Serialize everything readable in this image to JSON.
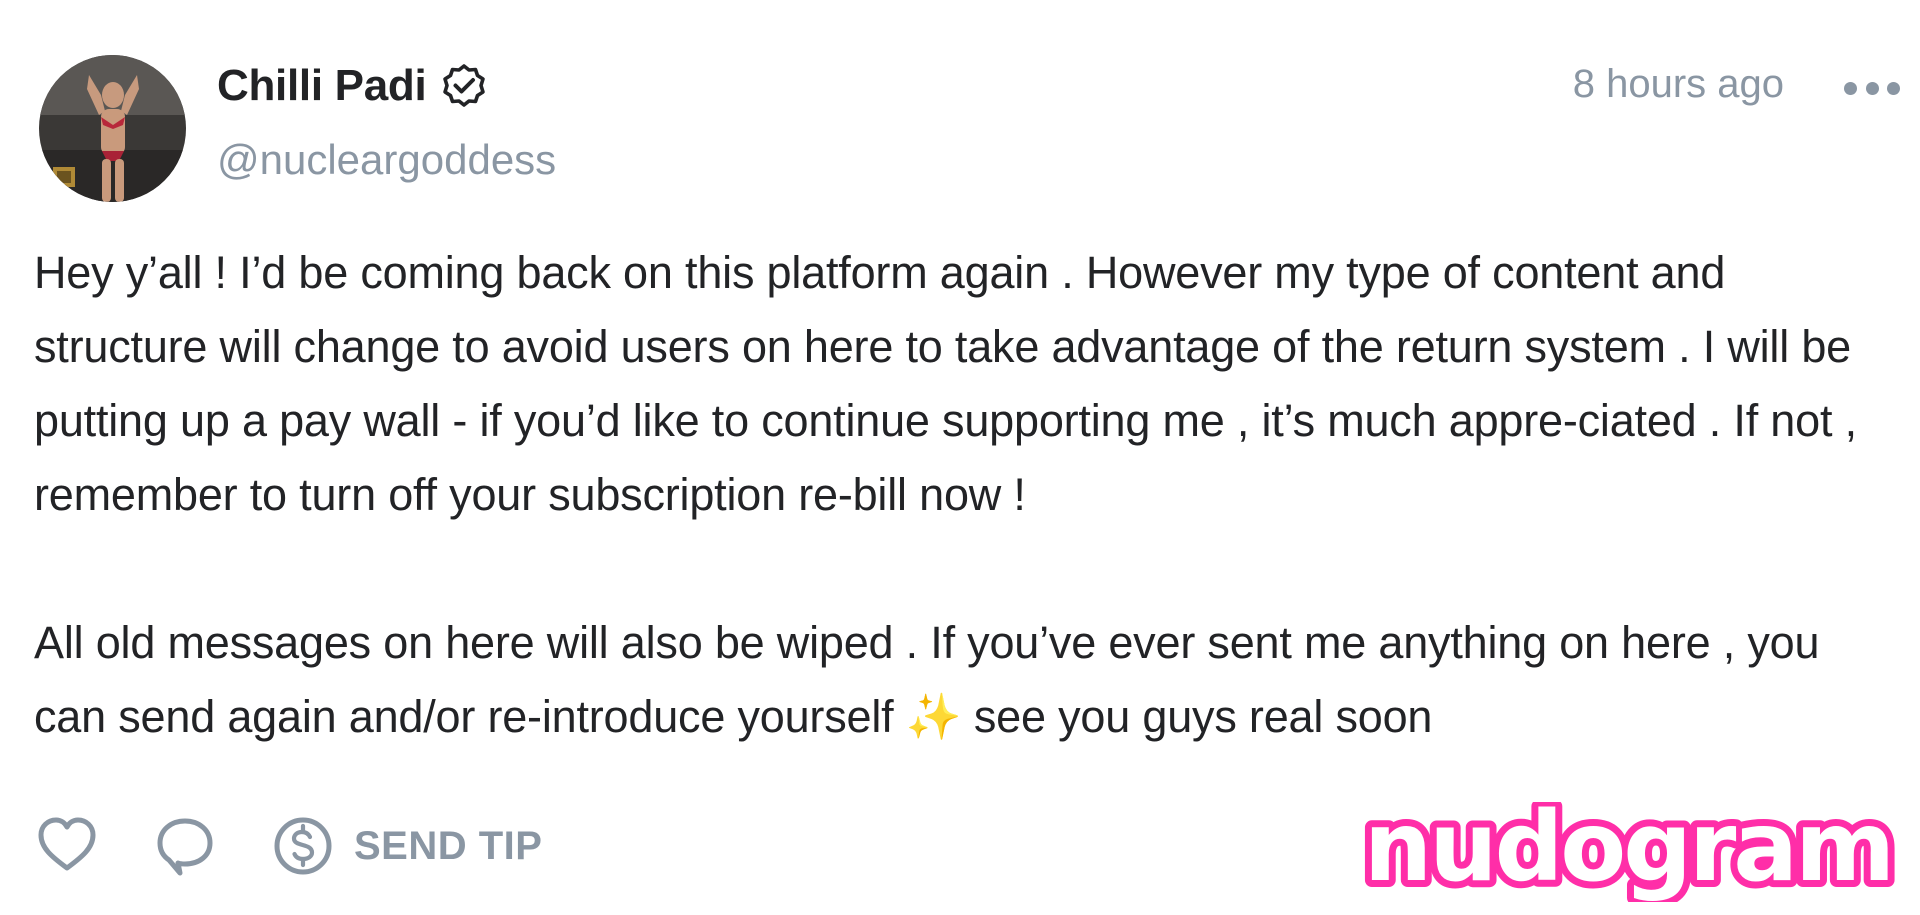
{
  "post": {
    "author": {
      "display_name": "Chilli Padi",
      "handle": "@nucleargoddess",
      "verified": true
    },
    "timestamp": "8 hours ago",
    "paragraphs": [
      "Hey y’all ! I’d be coming back on this platform again . However my type of content and structure will change to avoid users on here to take advantage of the return system . I will be putting up a pay wall - if you’d like to continue supporting me , it’s much appre-ciated . If not , remember to turn off your subscription re-bill now !",
      "All old messages on here will also be wiped . If you’ve ever sent me anything on here , you can send again and/or re-introduce yourself ✨ see you guys real soon"
    ],
    "actions": {
      "tip_label": "SEND TIP"
    }
  },
  "watermark": {
    "text": "nudogram"
  },
  "colors": {
    "text_primary": "#222326",
    "text_muted": "#8a96a3",
    "watermark_fill": "#ffffff",
    "watermark_stroke": "#ff2ea8"
  },
  "icons": {
    "verified": "verified-badge-icon",
    "more": "ellipsis-icon",
    "like": "heart-icon",
    "comment": "comment-bubble-icon",
    "tip": "dollar-circle-icon"
  }
}
